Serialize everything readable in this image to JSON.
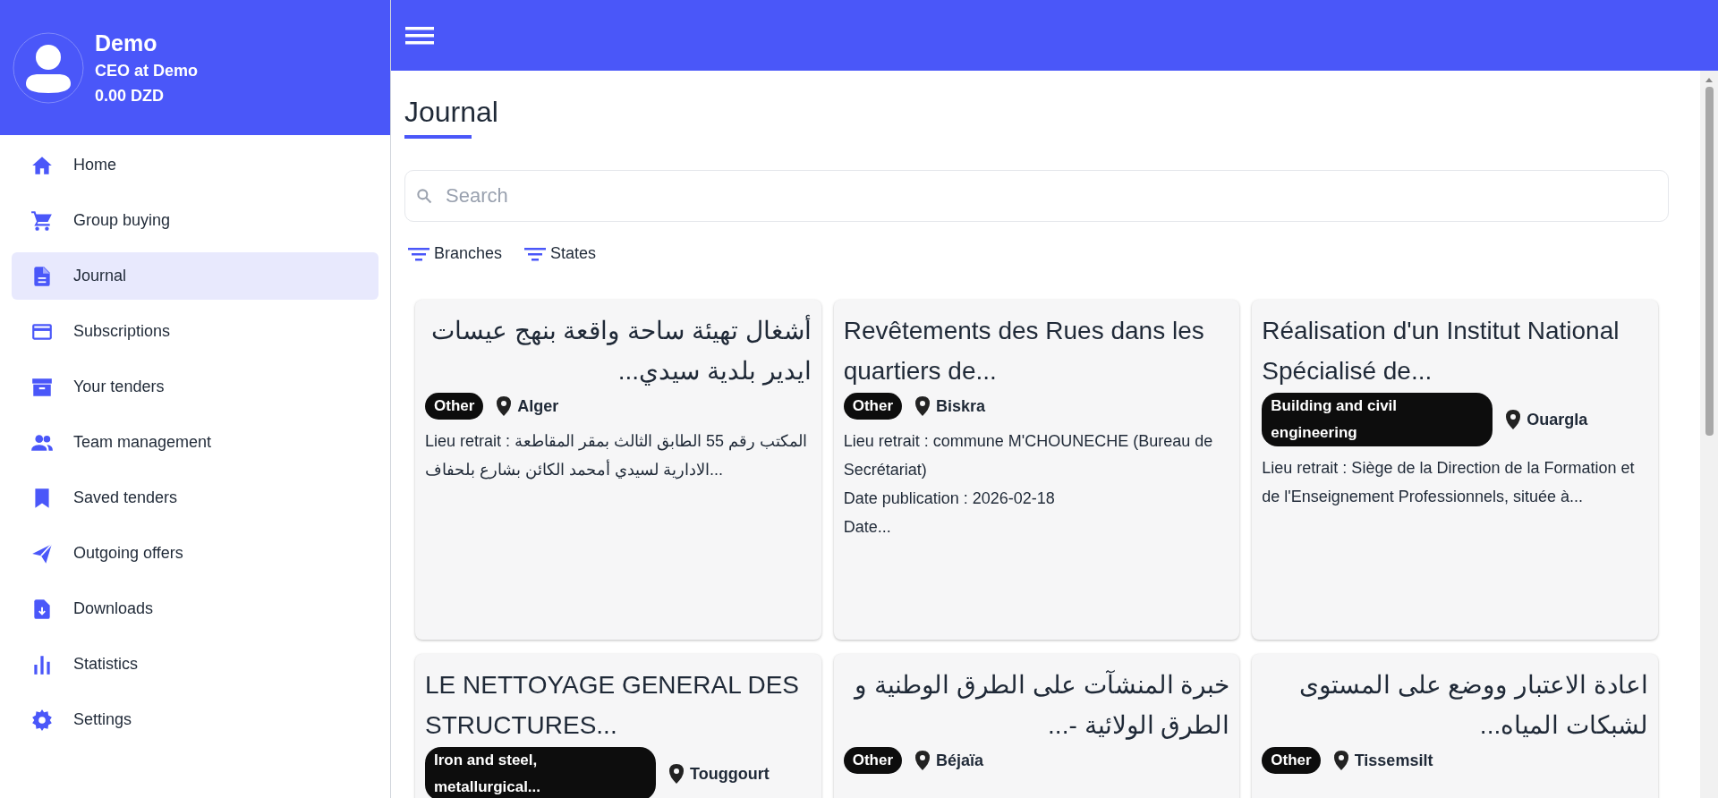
{
  "profile": {
    "name": "Demo",
    "role": "CEO at Demo",
    "balance": "0.00 DZD"
  },
  "sidebar": {
    "items": [
      {
        "label": "Home",
        "selected": false
      },
      {
        "label": "Group buying",
        "selected": false
      },
      {
        "label": "Journal",
        "selected": true
      },
      {
        "label": "Subscriptions",
        "selected": false
      },
      {
        "label": "Your tenders",
        "selected": false
      },
      {
        "label": "Team management",
        "selected": false
      },
      {
        "label": "Saved tenders",
        "selected": false
      },
      {
        "label": "Outgoing offers",
        "selected": false
      },
      {
        "label": "Downloads",
        "selected": false
      },
      {
        "label": "Statistics",
        "selected": false
      },
      {
        "label": "Settings",
        "selected": false
      }
    ]
  },
  "page": {
    "title": "Journal"
  },
  "search": {
    "placeholder": "Search"
  },
  "filters": [
    "Branches",
    "States"
  ],
  "cards": [
    {
      "title": "أشغال تهيئة ساحة واقعة بنهج عيسات ايدير بلدية سيدي...",
      "rtl": true,
      "tag": "Other",
      "location": "Alger",
      "description": "Lieu retrait : المكتب رقم 55 الطابق الثالث بمقر المقاطعة الادارية لسيدي أمحمد الكائن بشارع بلحفاف..."
    },
    {
      "title": "Revêtements des Rues dans les quartiers de...",
      "rtl": false,
      "tag": "Other",
      "location": "Biskra",
      "description": "Lieu retrait : commune M'CHOUNECHE (Bureau de Secrétariat)\nDate publication : 2026-02-18\nDate..."
    },
    {
      "title": "Réalisation d'un Institut National Spécialisé de...",
      "rtl": false,
      "tag": "Building and civil engineering",
      "location": "Ouargla",
      "description": "Lieu retrait : Siège de la Direction de la Formation et de l'Enseignement Professionnels, située à..."
    },
    {
      "title": "LE NETTOYAGE GENERAL DES STRUCTURES...",
      "rtl": false,
      "tag": "Iron and steel, metallurgical...",
      "location": "Touggourt"
    },
    {
      "title": "خبرة المنشآت على الطرق الوطنية و الطرق الولائية -...",
      "rtl": true,
      "tag": "Other",
      "location": "Béjaïa"
    },
    {
      "title": "اعادة الاعتبار ووضع على المستوى لشبكات المياه...",
      "rtl": true,
      "tag": "Other",
      "location": "Tissemsilt"
    }
  ]
}
